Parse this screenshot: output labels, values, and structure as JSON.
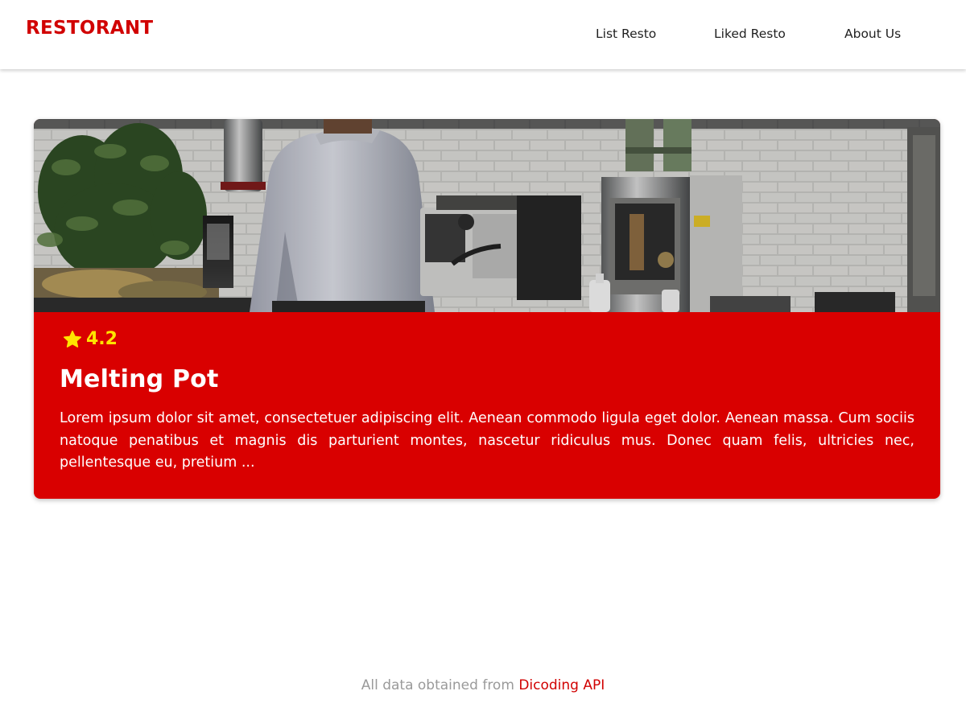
{
  "header": {
    "brand": "RESTORANT",
    "nav": [
      {
        "label": "List Resto"
      },
      {
        "label": "Liked Resto"
      },
      {
        "label": "About Us"
      }
    ]
  },
  "restaurant": {
    "image_icon": "restaurant-kitchen-photo",
    "rating_icon": "star-icon",
    "rating": "4.2",
    "name": "Melting Pot",
    "description": "Lorem ipsum dolor sit amet, consectetuer adipiscing elit. Aenean commodo ligula eget dolor. Aenean massa. Cum sociis natoque penatibus et magnis dis parturient montes, nascetur ridiculus mus. Donec quam felis, ultricies nec, pellentesque eu, pretium ..."
  },
  "footer": {
    "prefix": "All data obtained from ",
    "link": "Dicoding API"
  },
  "colors": {
    "brand": "#d10000",
    "card_background": "#d90000",
    "rating": "#ffe400",
    "footer_text": "#9a9a9a"
  }
}
